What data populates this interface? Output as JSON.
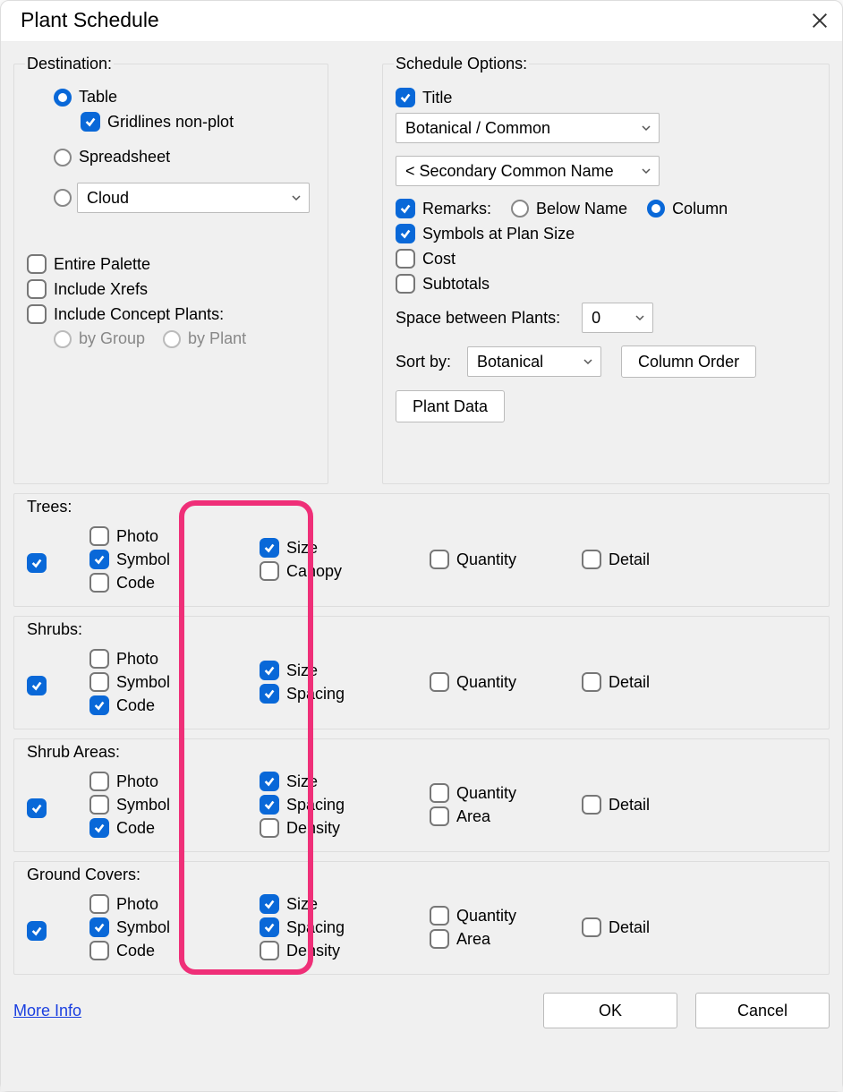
{
  "title": "Plant Schedule",
  "destination": {
    "legend": "Destination:",
    "options": {
      "table": {
        "label": "Table",
        "checked": true,
        "gridlines": {
          "label": "Gridlines non-plot",
          "checked": true
        }
      },
      "spreadsheet": {
        "label": "Spreadsheet",
        "checked": false
      },
      "cloud": {
        "checked": false,
        "select_value": "Cloud"
      }
    },
    "entire_palette": {
      "label": "Entire Palette",
      "checked": false
    },
    "include_xrefs": {
      "label": "Include Xrefs",
      "checked": false
    },
    "include_concept": {
      "label": "Include Concept Plants:",
      "checked": false,
      "by_group": "by Group",
      "by_plant": "by Plant"
    }
  },
  "schedule": {
    "legend": "Schedule Options:",
    "title_cb": {
      "label": "Title",
      "checked": true
    },
    "name_style": "Botanical / Common",
    "secondary": "< Secondary Common Name",
    "remarks": {
      "label": "Remarks:",
      "checked": true,
      "below_name": "Below Name",
      "column": "Column",
      "position": "column"
    },
    "symbols_plan": {
      "label": "Symbols at Plan Size",
      "checked": true
    },
    "cost": {
      "label": "Cost",
      "checked": false
    },
    "subtotals": {
      "label": "Subtotals",
      "checked": false
    },
    "space_label": "Space between Plants:",
    "space_value": "0",
    "sort_label": "Sort by:",
    "sort_value": "Botanical",
    "column_order": "Column Order",
    "plant_data": "Plant Data"
  },
  "labels": {
    "photo": "Photo",
    "symbol": "Symbol",
    "code": "Code",
    "size": "Size",
    "canopy": "Canopy",
    "spacing": "Spacing",
    "density": "Density",
    "quantity": "Quantity",
    "area": "Area",
    "detail": "Detail"
  },
  "categories": [
    {
      "name": "Trees:",
      "enabled": true,
      "photo": false,
      "symbol": true,
      "code": false,
      "col3": [
        [
          "size",
          true
        ],
        [
          "canopy",
          false
        ]
      ],
      "col4": [
        [
          "quantity",
          false
        ]
      ],
      "detail": false
    },
    {
      "name": "Shrubs:",
      "enabled": true,
      "photo": false,
      "symbol": false,
      "code": true,
      "col3": [
        [
          "size",
          true
        ],
        [
          "spacing",
          true
        ]
      ],
      "col4": [
        [
          "quantity",
          false
        ]
      ],
      "detail": false
    },
    {
      "name": "Shrub Areas:",
      "enabled": true,
      "photo": false,
      "symbol": false,
      "code": true,
      "col3": [
        [
          "size",
          true
        ],
        [
          "spacing",
          true
        ],
        [
          "density",
          false
        ]
      ],
      "col4": [
        [
          "quantity",
          false
        ],
        [
          "area",
          false
        ]
      ],
      "detail": false
    },
    {
      "name": "Ground Covers:",
      "enabled": true,
      "photo": false,
      "symbol": true,
      "code": false,
      "col3": [
        [
          "size",
          true
        ],
        [
          "spacing",
          true
        ],
        [
          "density",
          false
        ]
      ],
      "col4": [
        [
          "quantity",
          false
        ],
        [
          "area",
          false
        ]
      ],
      "detail": false
    }
  ],
  "footer": {
    "more_info": "More Info",
    "ok": "OK",
    "cancel": "Cancel"
  }
}
